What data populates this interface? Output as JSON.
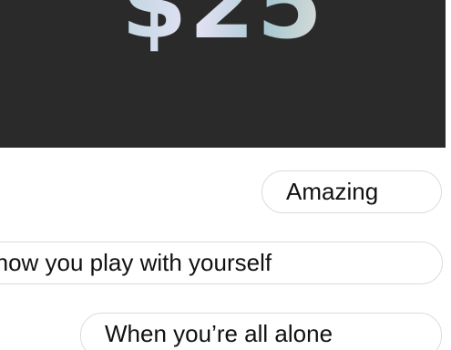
{
  "gift_card": {
    "amount": "$25"
  },
  "replies": [
    {
      "text": "Amazing"
    },
    {
      "text": "Love how you play with yourself"
    },
    {
      "text": "When you’re all alone"
    }
  ]
}
